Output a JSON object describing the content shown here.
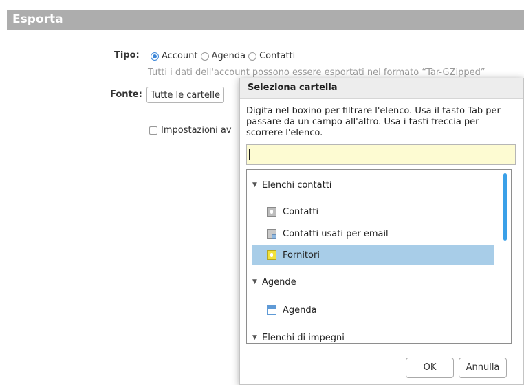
{
  "header": {
    "title": "Esporta"
  },
  "form": {
    "tipo_label": "Tipo:",
    "types": [
      {
        "label": "Account",
        "checked": true
      },
      {
        "label": "Agenda",
        "checked": false
      },
      {
        "label": "Contatti",
        "checked": false
      }
    ],
    "hint": "Tutti i dati dell'account possono essere esportati nel formato “Tar-GZipped”",
    "fonte_label": "Fonte:",
    "fonte_value": "Tutte le cartelle",
    "advanced_label": "Impostazioni av"
  },
  "dialog": {
    "title": "Seleziona cartella",
    "instructions": "Digita nel boxino per filtrare l'elenco. Usa il tasto Tab per passare da un campo all'altro. Usa i tasti freccia per scorrere l'elenco.",
    "filter_value": "",
    "tree": [
      {
        "label": "Elenchi contatti",
        "type": "group",
        "icon": "triangle-down-icon"
      },
      {
        "label": "Contatti",
        "type": "item",
        "icon": "contact-card-icon"
      },
      {
        "label": "Contatti usati per email",
        "type": "item",
        "icon": "contact-email-icon"
      },
      {
        "label": "Fornitori",
        "type": "item",
        "icon": "supplier-card-icon",
        "selected": true
      },
      {
        "label": "Agende",
        "type": "group",
        "icon": "triangle-down-icon"
      },
      {
        "label": "Agenda",
        "type": "item",
        "icon": "calendar-icon"
      },
      {
        "label": "Elenchi di impegni",
        "type": "group",
        "icon": "triangle-down-icon"
      }
    ],
    "ok_label": "OK",
    "cancel_label": "Annulla"
  },
  "colors": {
    "header_bg": "#adadad",
    "selected_row": "#a8cde8",
    "filter_bg": "#fdfbd2",
    "accent": "#3b86d8"
  }
}
